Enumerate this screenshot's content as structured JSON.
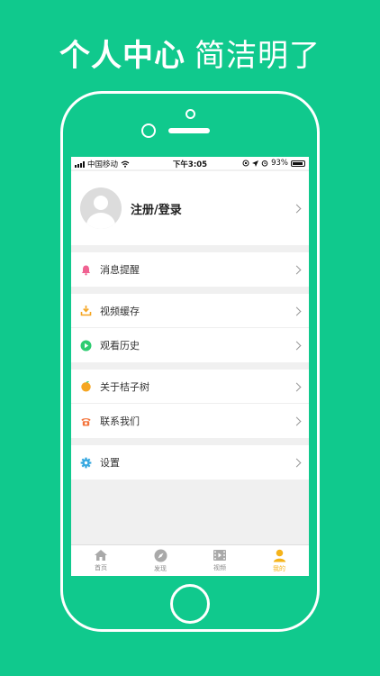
{
  "headline": {
    "bold": "个人中心",
    "light": "简洁明了"
  },
  "status_bar": {
    "carrier": "中国移动",
    "time": "下午3:05",
    "battery": "93%"
  },
  "profile": {
    "login_label": "注册/登录"
  },
  "menu_groups": [
    [
      {
        "label": "消息提醒",
        "icon": "bell-icon",
        "color": "#f06292"
      }
    ],
    [
      {
        "label": "视频缓存",
        "icon": "download-icon",
        "color": "#f5a623"
      },
      {
        "label": "观看历史",
        "icon": "play-icon",
        "color": "#2ecc71"
      }
    ],
    [
      {
        "label": "关于桔子树",
        "icon": "orange-icon",
        "color": "#f5a623"
      },
      {
        "label": "联系我们",
        "icon": "phone-icon",
        "color": "#f4743b"
      }
    ],
    [
      {
        "label": "设置",
        "icon": "gear-icon",
        "color": "#39a9e0"
      }
    ]
  ],
  "tabs": [
    {
      "label": "首页",
      "icon": "home-icon"
    },
    {
      "label": "发现",
      "icon": "compass-icon"
    },
    {
      "label": "视频",
      "icon": "film-icon"
    },
    {
      "label": "我的",
      "icon": "person-icon",
      "active": true
    }
  ],
  "colors": {
    "background": "#10c98d",
    "accent": "#f5b31a"
  }
}
